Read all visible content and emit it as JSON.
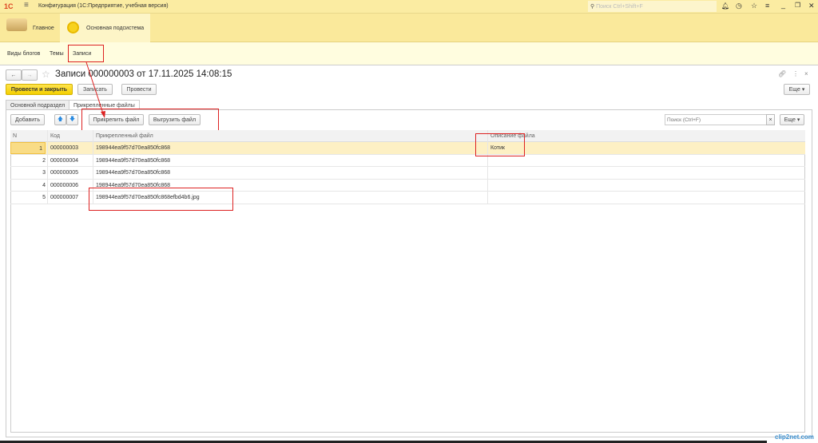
{
  "window": {
    "title": "Конфигурация  (1С:Предприятие, учебная версия)",
    "search_placeholder": "Поиск Ctrl+Shift+F"
  },
  "sections": [
    {
      "label": "Главное"
    },
    {
      "label": "Основная подсистема"
    }
  ],
  "nav": [
    {
      "label": "Виды блогов"
    },
    {
      "label": "Темы"
    },
    {
      "label": "Записи"
    }
  ],
  "form": {
    "title": "Записи 000000003 от 17.11.2025 14:08:15",
    "buttons": {
      "post_close": "Провести и закрыть",
      "save": "Записать",
      "post": "Провести",
      "more": "Еще ▾"
    },
    "tabs": [
      {
        "label": "Основной подраздел"
      },
      {
        "label": "Прикрепленные файлы"
      }
    ],
    "table_toolbar": {
      "add": "Добавить",
      "attach": "Прикрепить файл",
      "export": "Выгрузить файл",
      "search_placeholder": "Поиск (Ctrl+F)",
      "clear": "×",
      "more": "Еще ▾"
    },
    "table": {
      "columns": [
        "N",
        "Код",
        "Прикрепленный файл",
        "Описание файла"
      ],
      "rows": [
        {
          "n": "1",
          "code": "000000003",
          "file": "198944ea9f57d70ea850fc868",
          "desc": "Котик"
        },
        {
          "n": "2",
          "code": "000000004",
          "file": "198944ea9f57d70ea850fc868",
          "desc": ""
        },
        {
          "n": "3",
          "code": "000000005",
          "file": "198944ea9f57d70ea850fc868",
          "desc": ""
        },
        {
          "n": "4",
          "code": "000000006",
          "file": "198944ea9f57d70ea850fc868",
          "desc": ""
        },
        {
          "n": "5",
          "code": "000000007",
          "file": "198944ea9f57d70ea850fc868efbd4b6.jpg",
          "desc": ""
        }
      ]
    }
  },
  "watermark": "clip2net.com",
  "colors": {
    "accent": "#f4cf00",
    "annotation": "#d22222"
  }
}
